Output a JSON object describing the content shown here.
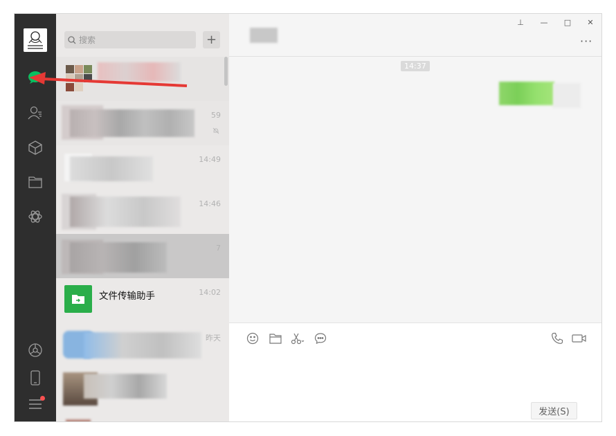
{
  "search": {
    "placeholder": "搜索"
  },
  "chats": [
    {
      "time": "",
      "name": ""
    },
    {
      "time": "59",
      "name": ""
    },
    {
      "time": "14:49",
      "name": ""
    },
    {
      "time": "14:46",
      "name": ""
    },
    {
      "time": "7",
      "name": ""
    },
    {
      "time": "14:02",
      "name": "文件传输助手"
    },
    {
      "time": "昨天",
      "name": ""
    }
  ],
  "conversation": {
    "timestamp": "14:37"
  },
  "input": {
    "send_label": "发送(S)"
  },
  "colors": {
    "nav_bg": "#2e2e2e",
    "accent_green": "#07c160",
    "arrow_red": "#e53935",
    "sent_bubble": "#95ec69"
  },
  "icons": [
    "chat-icon",
    "contacts-icon",
    "box-icon",
    "folder-icon",
    "mini-program-icon",
    "moments-icon",
    "phone-icon",
    "menu-icon"
  ]
}
